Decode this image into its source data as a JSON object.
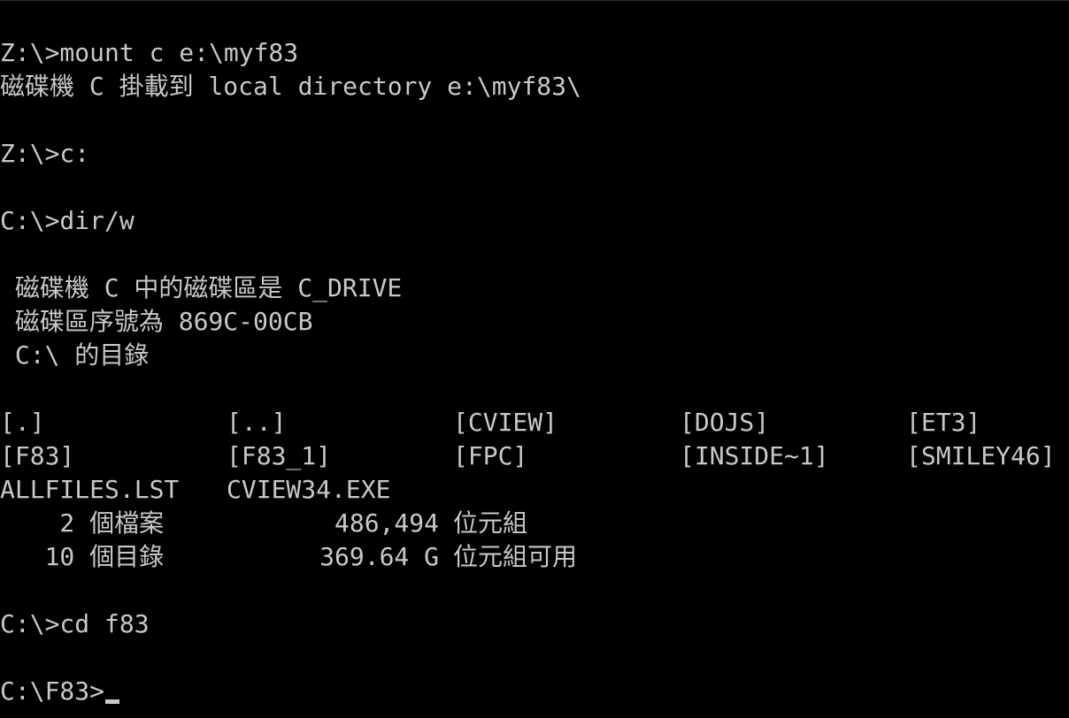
{
  "console": {
    "line1": "Z:\\>mount c e:\\myf83",
    "line2": "磁碟機 C 掛載到 local directory e:\\myf83\\",
    "line4": "Z:\\>c:",
    "line6": "C:\\>dir/w",
    "line8": " 磁碟機 C 中的磁碟區是 C_DRIVE",
    "line9": " 磁碟區序號為 869C-00CB",
    "line10": " C:\\ 的目錄",
    "listing_row1": [
      "[.]",
      "[..]",
      "[CVIEW]",
      "[DOJS]",
      "[ET3]"
    ],
    "listing_row2": [
      "[F83]",
      "[F83_1]",
      "[FPC]",
      "[INSIDE~1]",
      "[SMILEY46]"
    ],
    "listing_row3": [
      "ALLFILES.LST",
      "CVIEW34.EXE"
    ],
    "summary_files": {
      "count": "    2 個檔案",
      "number": "486,494",
      "unit": "位元組"
    },
    "summary_dirs": {
      "count": "   10 個目錄",
      "number": "369.64 G",
      "unit": "位元組可用"
    },
    "line17": "C:\\>cd f83",
    "prompt": "C:\\F83>"
  }
}
